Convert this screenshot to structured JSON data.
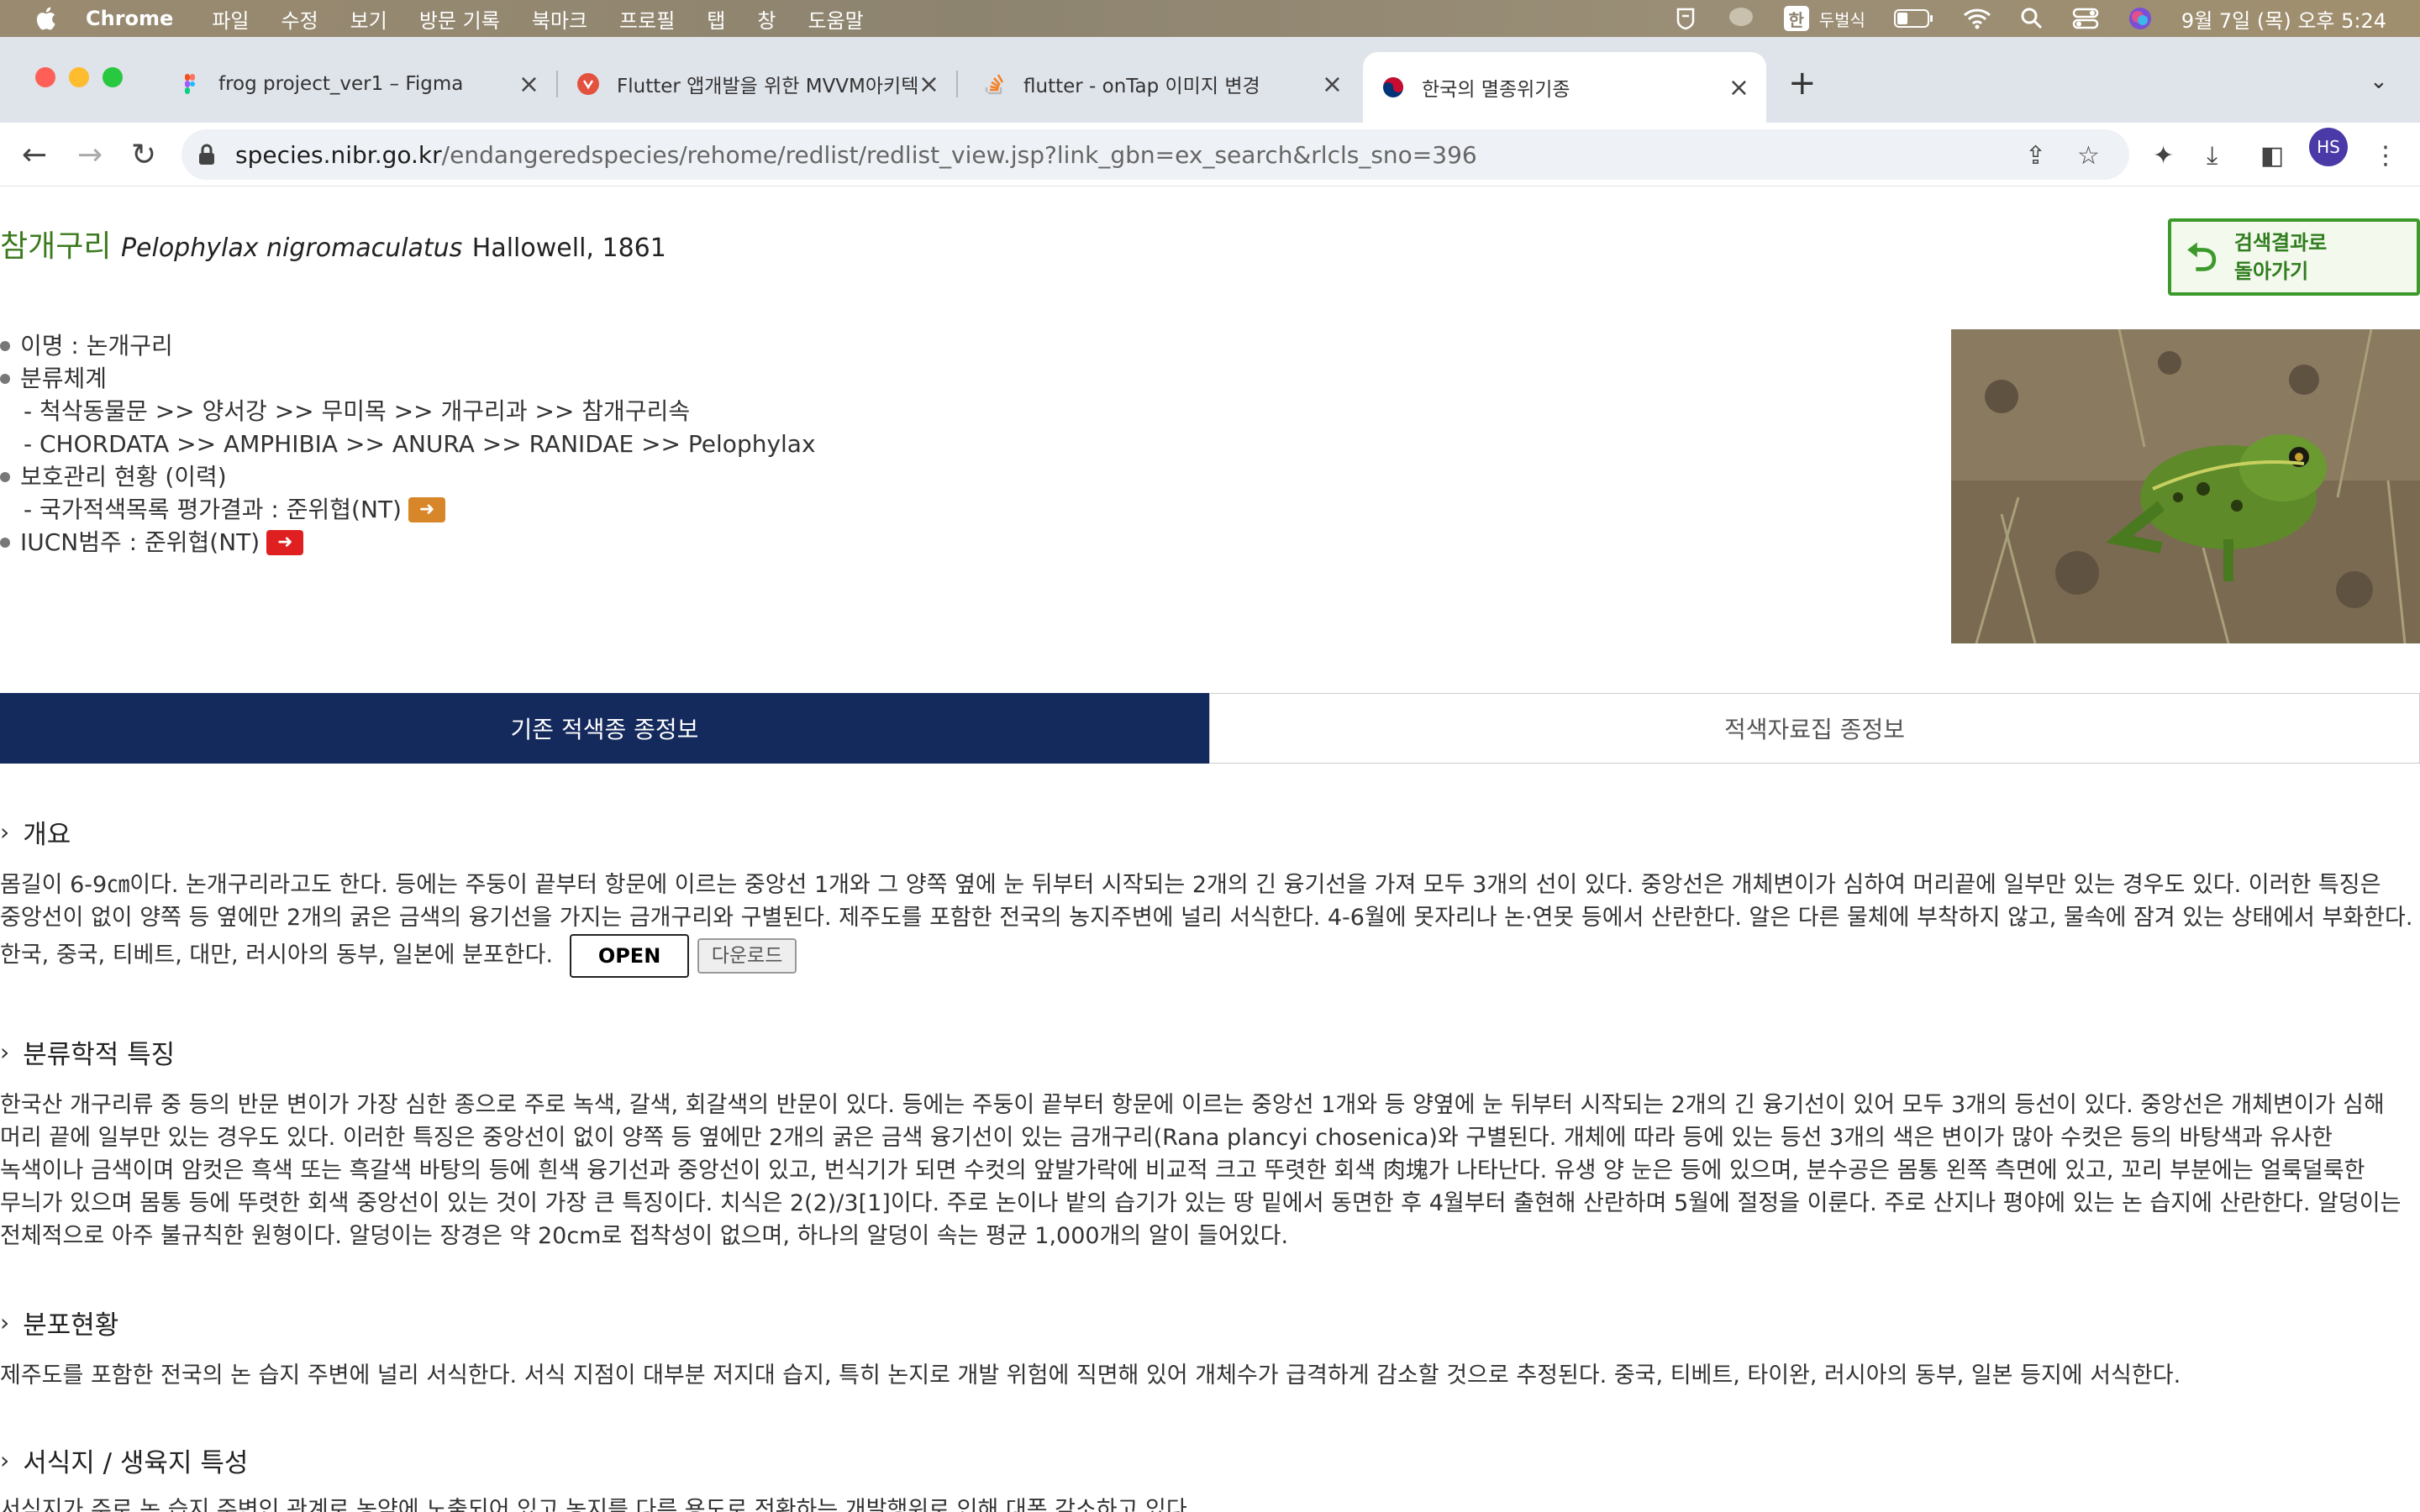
{
  "menubar": {
    "app": "Chrome",
    "items": [
      "파일",
      "수정",
      "보기",
      "방문 기록",
      "북마크",
      "프로필",
      "탭",
      "창",
      "도움말"
    ],
    "input_indicator": "한",
    "input_name": "두벌식",
    "clock": "9월 7일 (목) 오후 5:24"
  },
  "tabs": [
    {
      "title": "frog project_ver1 – Figma",
      "favicon": "figma-icon",
      "color": "#a259ff"
    },
    {
      "title": "Flutter 앱개발을 위한 MVVM아키텍",
      "favicon": "velog-icon",
      "color": "#e2523f"
    },
    {
      "title": "flutter - onTap 이미지 변경",
      "favicon": "stackoverflow-icon",
      "color": "#f48024"
    },
    {
      "title": "한국의 멸종위기종",
      "favicon": "korea-taegeuk-icon",
      "color": "#c60c30"
    }
  ],
  "url": {
    "host": "species.nibr.go.kr",
    "path": "/endangeredspecies/rehome/redlist/redlist_view.jsp?link_gbn=ex_search&rlcls_sno=396"
  },
  "profile_initials": "HS",
  "species": {
    "korean_name": "참개구리",
    "scientific_name": "Pelophylax nigromaculatus",
    "author": "Hallowell, 1861"
  },
  "back_button": {
    "line1": "검색결과로",
    "line2": "돌아가기"
  },
  "info": {
    "alias": "이명 : 논개구리",
    "taxonomy_label": "분류체계",
    "taxonomy_kr": "- 척삭동물문 >> 양서강 >> 무미목 >> 개구리과 >> 참개구리속",
    "taxonomy_en": "- CHORDATA >> AMPHIBIA >> ANURA >> RANIDAE >> Pelophylax",
    "protection_label": "보호관리 현황 (이력)",
    "national_redlist": "- 국가적색목록 평가결과 : 준위협(NT)",
    "iucn": "IUCN범주 : 준위협(NT)"
  },
  "content_tabs": [
    "기존 적색종 종정보",
    "적색자료집 종정보"
  ],
  "sections": [
    {
      "title": "개요",
      "text": "몸길이 6-9㎝이다. 논개구리라고도 한다. 등에는 주둥이 끝부터 항문에 이르는 중앙선 1개와 그 양쪽 옆에 눈 뒤부터 시작되는 2개의 긴 융기선을 가져 모두 3개의 선이 있다. 중앙선은 개체변이가 심하여 머리끝에 일부만 있는 경우도 있다. 이러한 특징은 중앙선이 없이 양쪽 등 옆에만 2개의 굵은 금색의 융기선을 가지는 금개구리와 구별된다. 제주도를 포함한 전국의 농지주변에 널리 서식한다. 4-6월에 못자리나 논·연못 등에서 산란한다. 알은 다른 물체에 부착하지 않고, 물속에 잠겨 있는 상태에서 부화한다. 한국, 중국, 티베트, 대만, 러시아의 동부, 일본에 분포한다."
    },
    {
      "title": "분류학적 특징",
      "text": "한국산 개구리류 중 등의 반문 변이가 가장 심한 종으로 주로 녹색, 갈색, 회갈색의 반문이 있다. 등에는 주둥이 끝부터 항문에 이르는 중앙선 1개와 등 양옆에 눈 뒤부터 시작되는 2개의 긴 융기선이 있어 모두 3개의 등선이 있다. 중앙선은 개체변이가 심해 머리 끝에 일부만 있는 경우도 있다. 이러한 특징은 중앙선이 없이 양쪽 등 옆에만 2개의 굵은 금색 융기선이 있는 금개구리(Rana plancyi chosenica)와 구별된다. 개체에 따라 등에 있는 등선 3개의 색은 변이가 많아 수컷은 등의 바탕색과 유사한 녹색이나 금색이며 암컷은 흑색 또는 흑갈색 바탕의 등에 흰색 융기선과 중앙선이 있고, 번식기가 되면 수컷의 앞발가락에 비교적 크고 뚜렷한 회색 肉塊가 나타난다. 유생 양 눈은 등에 있으며, 분수공은 몸통 왼쪽 측면에 있고, 꼬리 부분에는 얼룩덜룩한 무늬가 있으며 몸통 등에 뚜렷한 회색 중앙선이 있는 것이 가장 큰 특징이다. 치식은 2(2)/3[1]이다. 주로 논이나 밭의 습기가 있는 땅 밑에서 동면한 후 4월부터 출현해 산란하며 5월에 절정을 이룬다. 주로 산지나 평야에 있는 논 습지에 산란한다. 알덩이는 전체적으로 아주 불규칙한 원형이다. 알덩이는 장경은 약 20cm로 접착성이 없으며, 하나의 알덩이 속는 평균 1,000개의 알이 들어있다."
    },
    {
      "title": "분포현황",
      "text": "제주도를 포함한 전국의 논 습지 주변에 널리 서식한다. 서식 지점이 대부분 저지대 습지, 특히 논지로 개발 위험에 직면해 있어 개체수가 급격하게 감소할 것으로 추정된다. 중국, 티베트, 타이완, 러시아의 동부, 일본 등지에 서식한다."
    },
    {
      "title": "서식지 / 생육지 특성",
      "text": "서식지가 주로 논 습지 주변인 관계로 농약에 노출되어 있고 농지를 다른 용도로 전환하는 개발행위로 인해 대폭 감소하고 있다."
    }
  ],
  "license": {
    "open_label": "OPEN",
    "download_label": "다운로드"
  }
}
